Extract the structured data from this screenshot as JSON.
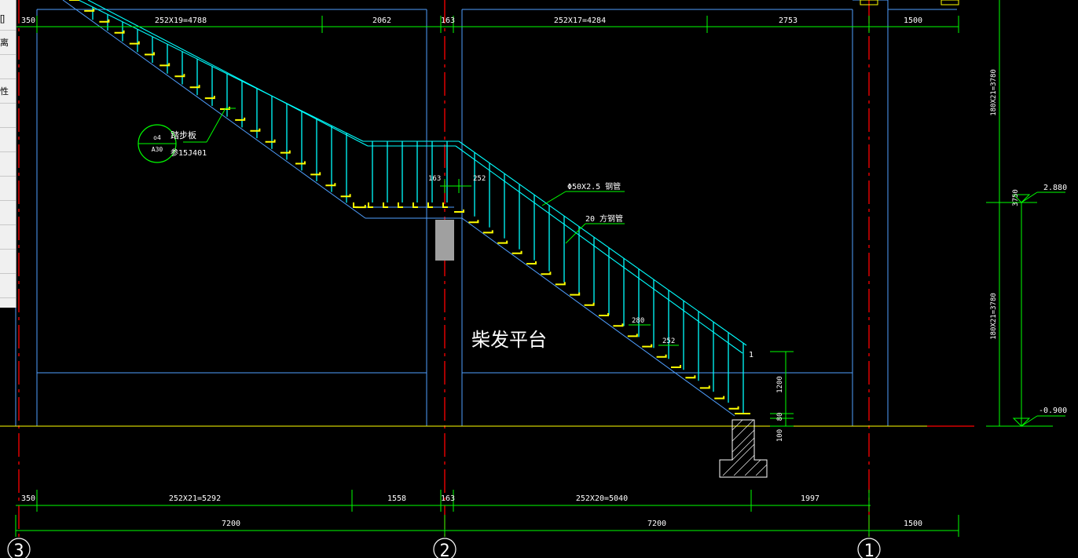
{
  "colors": {
    "background": "#000000",
    "axis": "#ff0000",
    "dimension": "#00ff00",
    "structure": "#4f9fff",
    "railing": "#00ffff",
    "tread": "#ffff00",
    "text": "#ffffff"
  },
  "side_panel": {
    "items": [
      "[]",
      "离",
      "",
      "性",
      "",
      "",
      "",
      "",
      "",
      "",
      "",
      ""
    ]
  },
  "dimensions_top": {
    "d1": "350",
    "d2": "252X19=4788",
    "d3": "2062",
    "d4": "163",
    "d5": "252X17=4284",
    "d6": "2753",
    "d7": "1500"
  },
  "dimensions_bottom": {
    "d1": "350",
    "d2": "252X21=5292",
    "d3": "1558",
    "d4": "163",
    "d5": "252X20=5040",
    "d6": "1997",
    "span1": "7200",
    "span2": "7200",
    "span3": "1500"
  },
  "axes": {
    "left": "3",
    "middle": "2",
    "right": "1"
  },
  "annotations": {
    "detail_top": "o4",
    "detail_bottom": "A30",
    "tread_name": "踏步板",
    "tread_ref": "参15J401",
    "steel_pipe": "Φ50X2.5   钢管",
    "square_pipe": "20  方钢管",
    "platform_label": "柴发平台",
    "landing_163": "163",
    "landing_252": "252",
    "tread_280": "280",
    "tread_252": "252",
    "rail_height": "1200",
    "rail_80": "80",
    "rail_100": "100",
    "end_mark": "1",
    "level_upper": "2.880",
    "level_lower": "-0.900",
    "vert_upper": "180X21=3780",
    "vert_lower": "180X21=3780",
    "vert_mid": "3750"
  }
}
